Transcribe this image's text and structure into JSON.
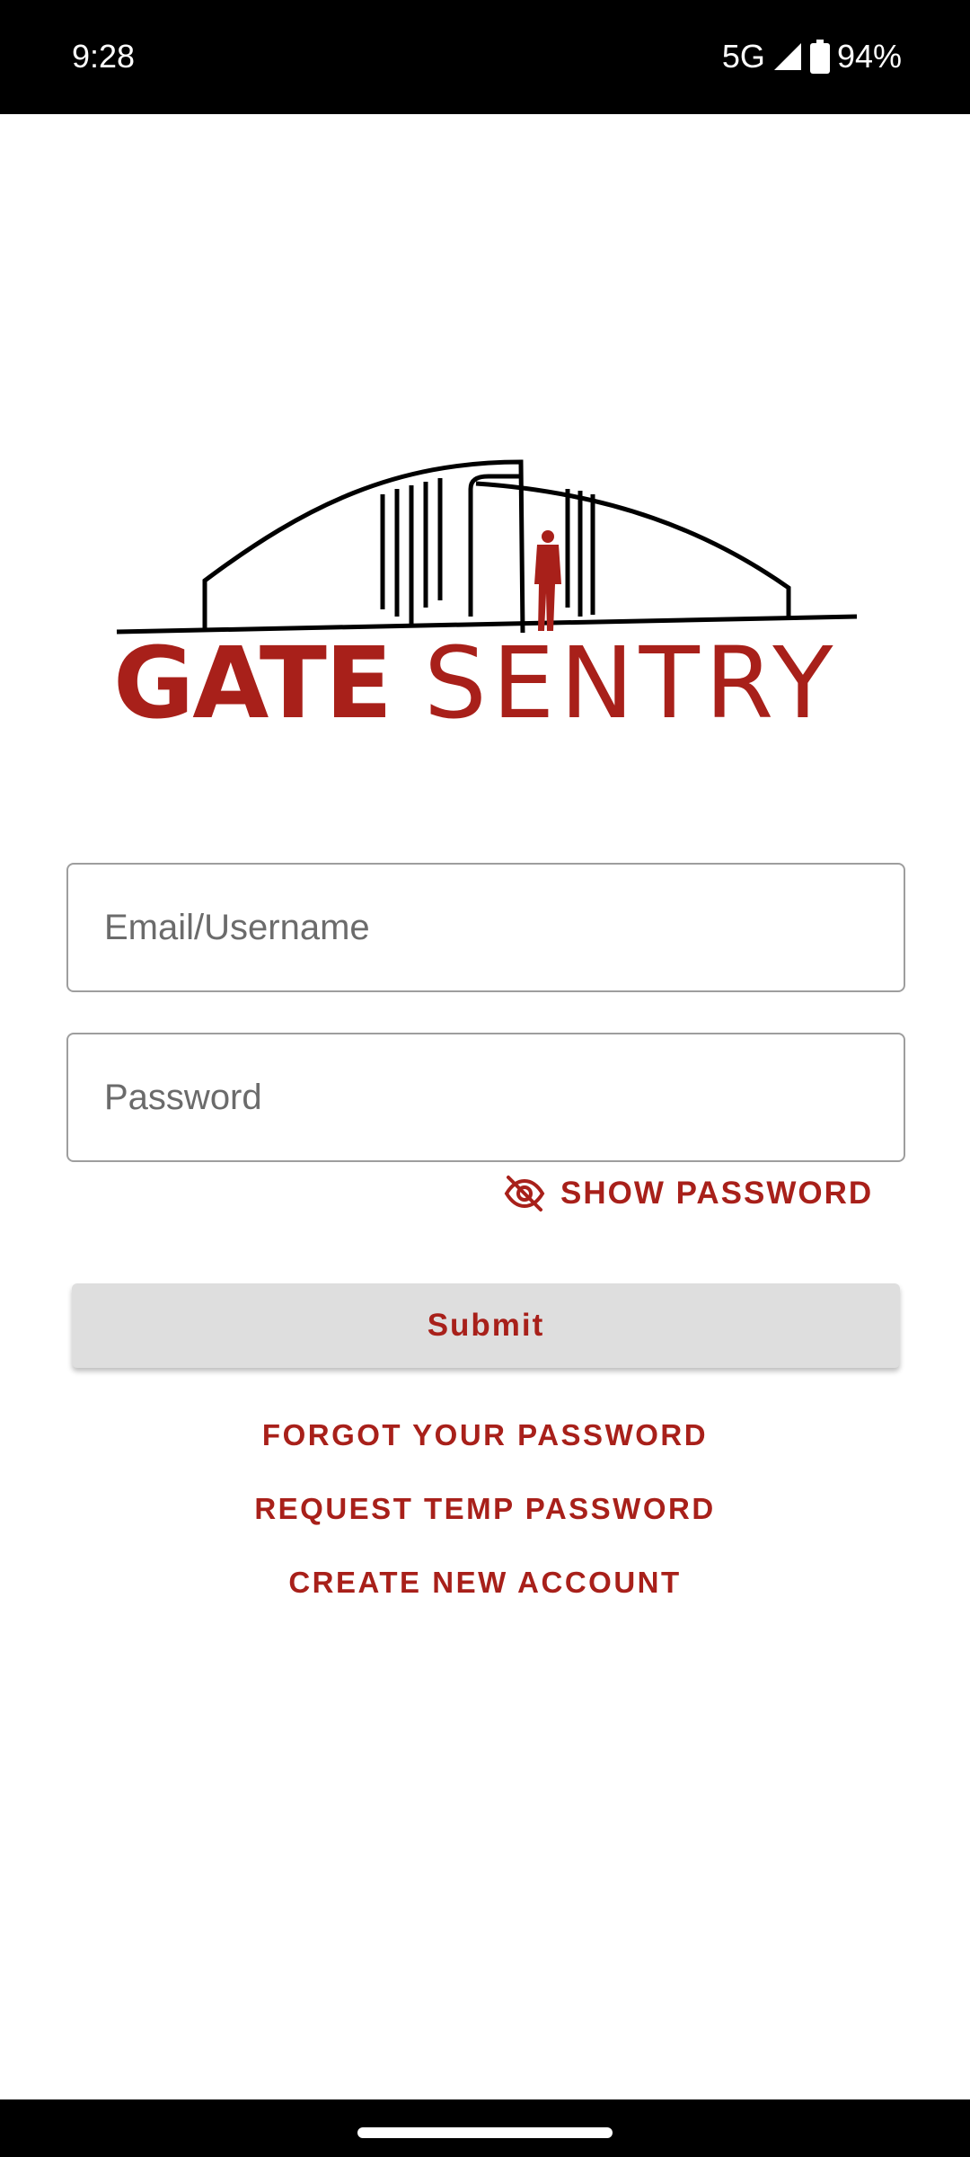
{
  "status_bar": {
    "time": "9:28",
    "network": "5G",
    "battery": "94%",
    "signal_icon": "signal-icon",
    "battery_icon": "battery-icon"
  },
  "logo": {
    "word_bold": "GATE",
    "word_light": "SENTRY",
    "brand_color": "#a8201a"
  },
  "form": {
    "email_placeholder": "Email/Username",
    "email_value": "",
    "password_placeholder": "Password",
    "password_value": "",
    "show_password_label": "SHOW PASSWORD",
    "show_password_icon": "eye-off-icon",
    "submit_label": "Submit"
  },
  "links": {
    "forgot": "FORGOT YOUR PASSWORD",
    "temp": "REQUEST TEMP PASSWORD",
    "create": "CREATE NEW ACCOUNT"
  },
  "colors": {
    "accent": "#a8201a",
    "button_bg": "#dedede",
    "border": "#9e9e9e"
  }
}
